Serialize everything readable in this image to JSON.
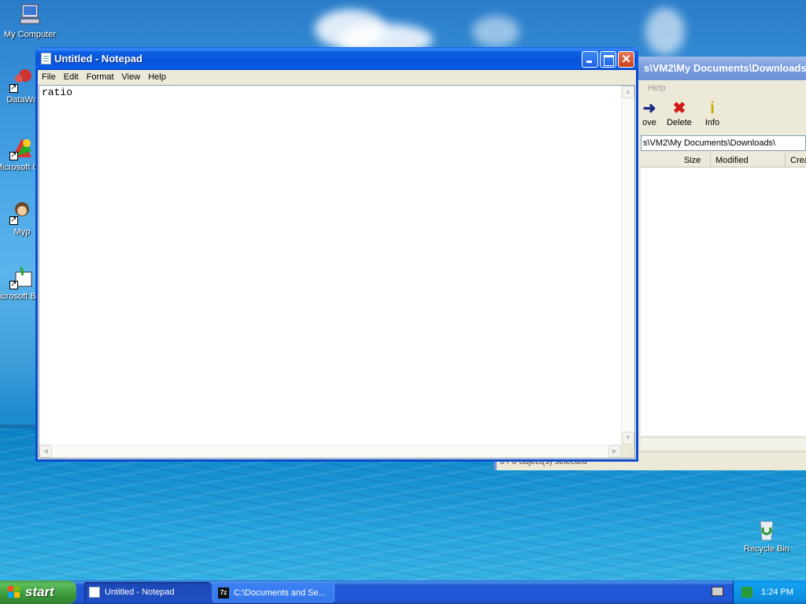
{
  "desktop": {
    "icons": [
      {
        "label": "My Computer",
        "icon": "my-computer-icon"
      },
      {
        "label": "DataWa",
        "icon": "datawarrior-icon"
      },
      {
        "label": "Microsoft C++",
        "icon": "msvc-icon"
      },
      {
        "label": "Myp",
        "icon": "myp-icon"
      },
      {
        "label": "Microsoft Basic",
        "icon": "msbasic-icon"
      },
      {
        "label": "Recycle Bin",
        "icon": "recycle-bin-icon"
      }
    ]
  },
  "zip_window": {
    "title": "s\\VM2\\My Documents\\Downloads\\",
    "menu_help": "Help",
    "tools": {
      "move": "ove",
      "delete": "Delete",
      "info": "Info"
    },
    "address": "s\\VM2\\My Documents\\Downloads\\",
    "columns": {
      "size": "Size",
      "modified": "Modified",
      "created": "Crea"
    },
    "status": "0 / 0 object(s) selected"
  },
  "notepad": {
    "title": "Untitled - Notepad",
    "menu": {
      "file": "File",
      "edit": "Edit",
      "format": "Format",
      "view": "View",
      "help": "Help"
    },
    "text": "ratio"
  },
  "taskbar": {
    "start_label": "start",
    "tasks": [
      {
        "label": "Untitled - Notepad",
        "active": true
      },
      {
        "label": "C:\\Documents and Se...",
        "active": false
      }
    ],
    "clock": "1:24 PM"
  },
  "colors": {
    "titlebar_active": "#0a53d8",
    "start_green": "#3c9a3c",
    "taskbar_blue": "#2157d7"
  }
}
